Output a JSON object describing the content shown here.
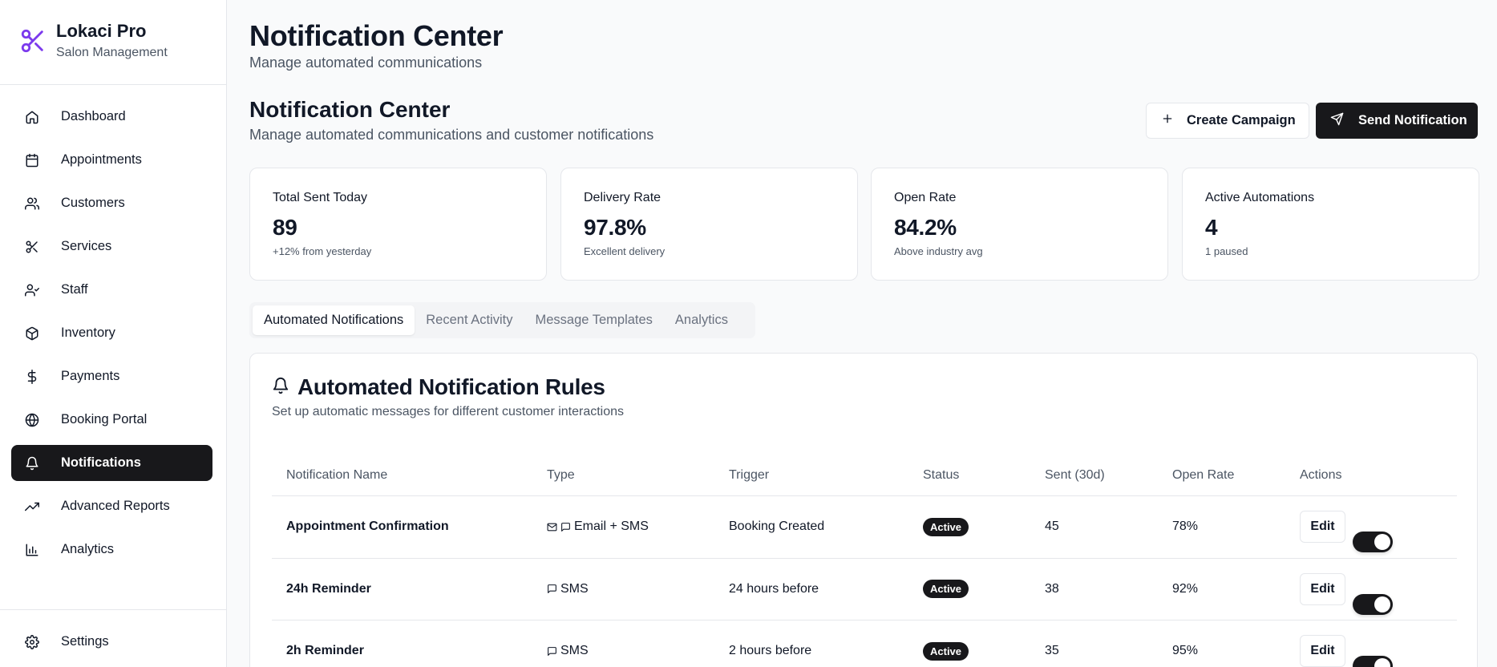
{
  "brand": {
    "title": "Lokaci Pro",
    "subtitle": "Salon Management"
  },
  "sidebar": {
    "items": [
      {
        "label": "Dashboard",
        "icon": "home-icon"
      },
      {
        "label": "Appointments",
        "icon": "calendar-icon"
      },
      {
        "label": "Customers",
        "icon": "users-icon"
      },
      {
        "label": "Services",
        "icon": "scissors-icon"
      },
      {
        "label": "Staff",
        "icon": "user-check-icon"
      },
      {
        "label": "Inventory",
        "icon": "package-icon"
      },
      {
        "label": "Payments",
        "icon": "dollar-icon"
      },
      {
        "label": "Booking Portal",
        "icon": "globe-icon"
      },
      {
        "label": "Notifications",
        "icon": "bell-icon",
        "active": true
      },
      {
        "label": "Advanced Reports",
        "icon": "trending-up-icon"
      },
      {
        "label": "Analytics",
        "icon": "bar-chart-icon"
      }
    ],
    "settings": {
      "label": "Settings",
      "icon": "gear-icon"
    }
  },
  "header": {
    "title": "Notification Center",
    "subtitle": "Manage automated communications"
  },
  "section": {
    "title": "Notification Center",
    "subtitle": "Manage automated communications and customer notifications",
    "create_label": "Create Campaign",
    "send_label": "Send Notification"
  },
  "stats": [
    {
      "label": "Total Sent Today",
      "value": "89",
      "note": "+12% from yesterday"
    },
    {
      "label": "Delivery Rate",
      "value": "97.8%",
      "note": "Excellent delivery"
    },
    {
      "label": "Open Rate",
      "value": "84.2%",
      "note": "Above industry avg"
    },
    {
      "label": "Active Automations",
      "value": "4",
      "note": "1 paused"
    }
  ],
  "tabs": [
    {
      "label": "Automated Notifications",
      "active": true
    },
    {
      "label": "Recent Activity"
    },
    {
      "label": "Message Templates"
    },
    {
      "label": "Analytics"
    }
  ],
  "rules": {
    "title": "Automated Notification Rules",
    "subtitle": "Set up automatic messages for different customer interactions",
    "columns": [
      "Notification Name",
      "Type",
      "Trigger",
      "Status",
      "Sent (30d)",
      "Open Rate",
      "Actions"
    ],
    "rows": [
      {
        "name": "Appointment Confirmation",
        "type": "Email + SMS",
        "channels": [
          "mail-icon",
          "message-icon"
        ],
        "trigger": "Booking Created",
        "status": "Active",
        "sent": "45",
        "open_rate": "78%",
        "edit": "Edit",
        "enabled": true
      },
      {
        "name": "24h Reminder",
        "type": "SMS",
        "channels": [
          "message-icon"
        ],
        "trigger": "24 hours before",
        "status": "Active",
        "sent": "38",
        "open_rate": "92%",
        "edit": "Edit",
        "enabled": true
      },
      {
        "name": "2h Reminder",
        "type": "SMS",
        "channels": [
          "message-icon"
        ],
        "trigger": "2 hours before",
        "status": "Active",
        "sent": "35",
        "open_rate": "95%",
        "edit": "Edit",
        "enabled": true
      }
    ]
  },
  "colors": {
    "accent": "#7c3aed",
    "dark": "#18181b",
    "muted": "#4b5563",
    "border": "#e5e7eb"
  }
}
